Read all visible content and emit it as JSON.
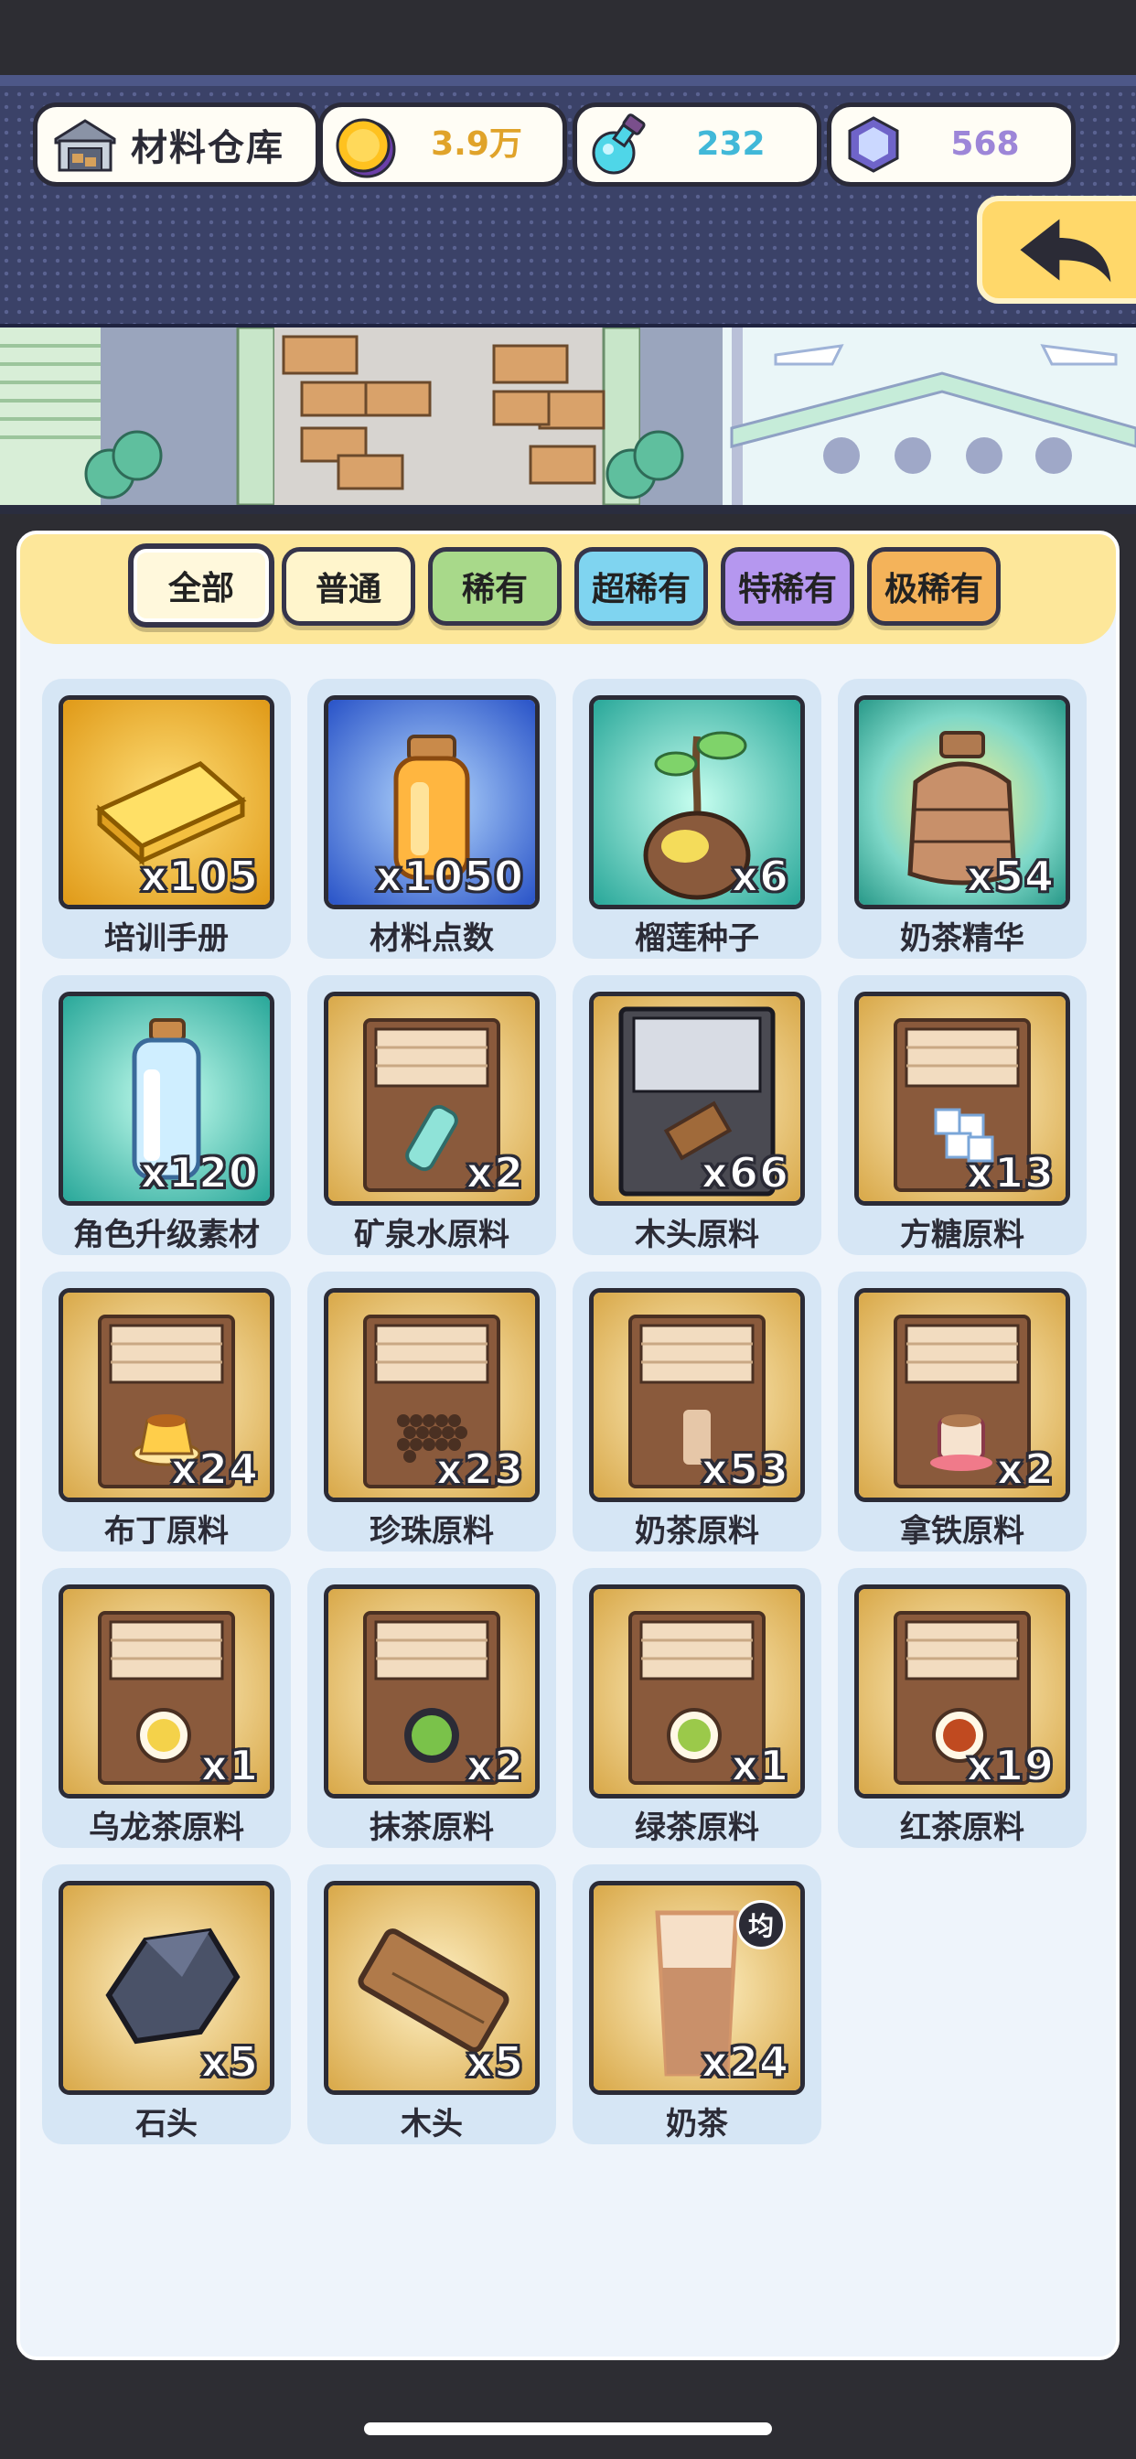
{
  "header": {
    "title": "材料仓库",
    "title_icon": "warehouse-icon",
    "resources": [
      {
        "icon": "gold-coin-icon",
        "value": "3.9万",
        "color": "#e0a32a"
      },
      {
        "icon": "potion-flask-icon",
        "value": "232",
        "color": "#41b8d8"
      },
      {
        "icon": "hexagon-gem-icon",
        "value": "568",
        "color": "#9d86d8"
      }
    ],
    "back_icon": "back-arrow-icon"
  },
  "tabs": [
    {
      "label": "全部",
      "active": true,
      "color": "#fff8dc"
    },
    {
      "label": "普通",
      "active": false,
      "color": "#fff5cc"
    },
    {
      "label": "稀有",
      "active": false,
      "color": "#a8d98a"
    },
    {
      "label": "超稀有",
      "active": false,
      "color": "#7fd4f0"
    },
    {
      "label": "特稀有",
      "active": false,
      "color": "#b597ef"
    },
    {
      "label": "极稀有",
      "active": false,
      "color": "#f4b35a"
    }
  ],
  "items": [
    {
      "name": "培训手册",
      "qty": "x105",
      "icon": "golden-book-icon",
      "bg": "gold"
    },
    {
      "name": "材料点数",
      "qty": "x1050",
      "icon": "orange-bottle-icon",
      "bg": "blue"
    },
    {
      "name": "榴莲种子",
      "qty": "x6",
      "icon": "durian-seed-icon",
      "bg": "teal"
    },
    {
      "name": "奶茶精华",
      "qty": "x54",
      "icon": "tea-jar-icon",
      "bg": "teal"
    },
    {
      "name": "角色升级素材",
      "qty": "x120",
      "icon": "blue-bottle-icon",
      "bg": "teal"
    },
    {
      "name": "矿泉水原料",
      "qty": "x2",
      "icon": "water-bottle-crate-icon",
      "bg": "crate"
    },
    {
      "name": "木头原料",
      "qty": "x66",
      "icon": "wood-metal-crate-icon",
      "bg": "metal"
    },
    {
      "name": "方糖原料",
      "qty": "x13",
      "icon": "sugar-cube-crate-icon",
      "bg": "crate"
    },
    {
      "name": "布丁原料",
      "qty": "x24",
      "icon": "pudding-crate-icon",
      "bg": "crate"
    },
    {
      "name": "珍珠原料",
      "qty": "x23",
      "icon": "pearl-crate-icon",
      "bg": "crate"
    },
    {
      "name": "奶茶原料",
      "qty": "x53",
      "icon": "milk-tea-cup-crate-icon",
      "bg": "crate"
    },
    {
      "name": "拿铁原料",
      "qty": "x2",
      "icon": "latte-crate-icon",
      "bg": "crate"
    },
    {
      "name": "乌龙茶原料",
      "qty": "x1",
      "icon": "oolong-crate-icon",
      "bg": "crate"
    },
    {
      "name": "抹茶原料",
      "qty": "x2",
      "icon": "matcha-crate-icon",
      "bg": "crate"
    },
    {
      "name": "绿茶原料",
      "qty": "x1",
      "icon": "green-tea-crate-icon",
      "bg": "crate"
    },
    {
      "name": "红茶原料",
      "qty": "x19",
      "icon": "black-tea-crate-icon",
      "bg": "crate"
    },
    {
      "name": "石头",
      "qty": "x5",
      "icon": "stone-icon",
      "bg": "crate"
    },
    {
      "name": "木头",
      "qty": "x5",
      "icon": "wood-plank-icon",
      "bg": "crate"
    },
    {
      "name": "奶茶",
      "qty": "x24",
      "icon": "milk-tea-glass-icon",
      "bg": "crate",
      "badge": "均"
    }
  ]
}
